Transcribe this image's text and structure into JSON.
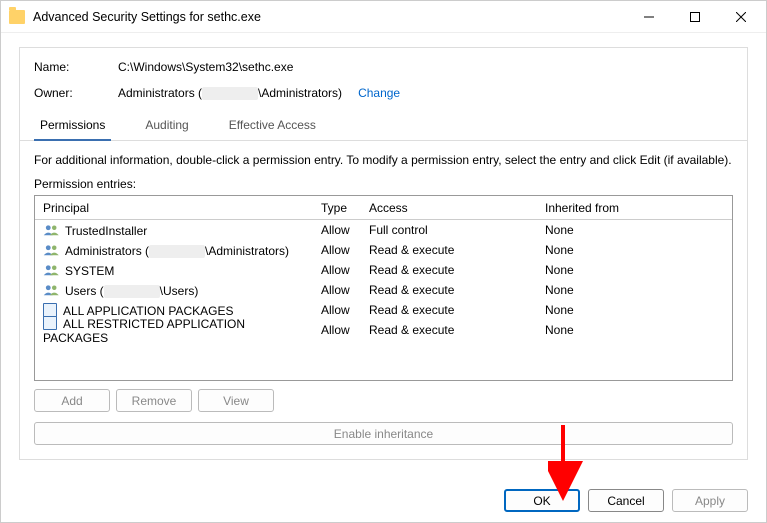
{
  "window": {
    "title": "Advanced Security Settings for sethc.exe"
  },
  "name_row": {
    "label": "Name:",
    "value": "C:\\Windows\\System32\\sethc.exe"
  },
  "owner_row": {
    "label": "Owner:",
    "prefix": "Administrators (",
    "suffix": "\\Administrators)",
    "change": "Change"
  },
  "tabs": {
    "permissions": "Permissions",
    "auditing": "Auditing",
    "effective": "Effective Access"
  },
  "help_text": "For additional information, double-click a permission entry. To modify a permission entry, select the entry and click Edit (if available).",
  "entries_label": "Permission entries:",
  "columns": {
    "principal": "Principal",
    "type": "Type",
    "access": "Access",
    "inherited": "Inherited from"
  },
  "rows": [
    {
      "icon": "users",
      "principal_pre": "TrustedInstaller",
      "principal_mid": "",
      "principal_post": "",
      "type": "Allow",
      "access": "Full control",
      "inherited": "None"
    },
    {
      "icon": "users",
      "principal_pre": "Administrators (",
      "principal_mid": "[redacted]",
      "principal_post": "\\Administrators)",
      "type": "Allow",
      "access": "Read & execute",
      "inherited": "None"
    },
    {
      "icon": "users",
      "principal_pre": "SYSTEM",
      "principal_mid": "",
      "principal_post": "",
      "type": "Allow",
      "access": "Read & execute",
      "inherited": "None"
    },
    {
      "icon": "users",
      "principal_pre": "Users (",
      "principal_mid": "[redacted]",
      "principal_post": "\\Users)",
      "type": "Allow",
      "access": "Read & execute",
      "inherited": "None"
    },
    {
      "icon": "pkg",
      "principal_pre": "ALL APPLICATION PACKAGES",
      "principal_mid": "",
      "principal_post": "",
      "type": "Allow",
      "access": "Read & execute",
      "inherited": "None"
    },
    {
      "icon": "pkg",
      "principal_pre": "ALL RESTRICTED APPLICATION PACKAGES",
      "principal_mid": "",
      "principal_post": "",
      "type": "Allow",
      "access": "Read & execute",
      "inherited": "None"
    }
  ],
  "buttons": {
    "add": "Add",
    "remove": "Remove",
    "view": "View",
    "enable_inheritance": "Enable inheritance",
    "ok": "OK",
    "cancel": "Cancel",
    "apply": "Apply"
  }
}
